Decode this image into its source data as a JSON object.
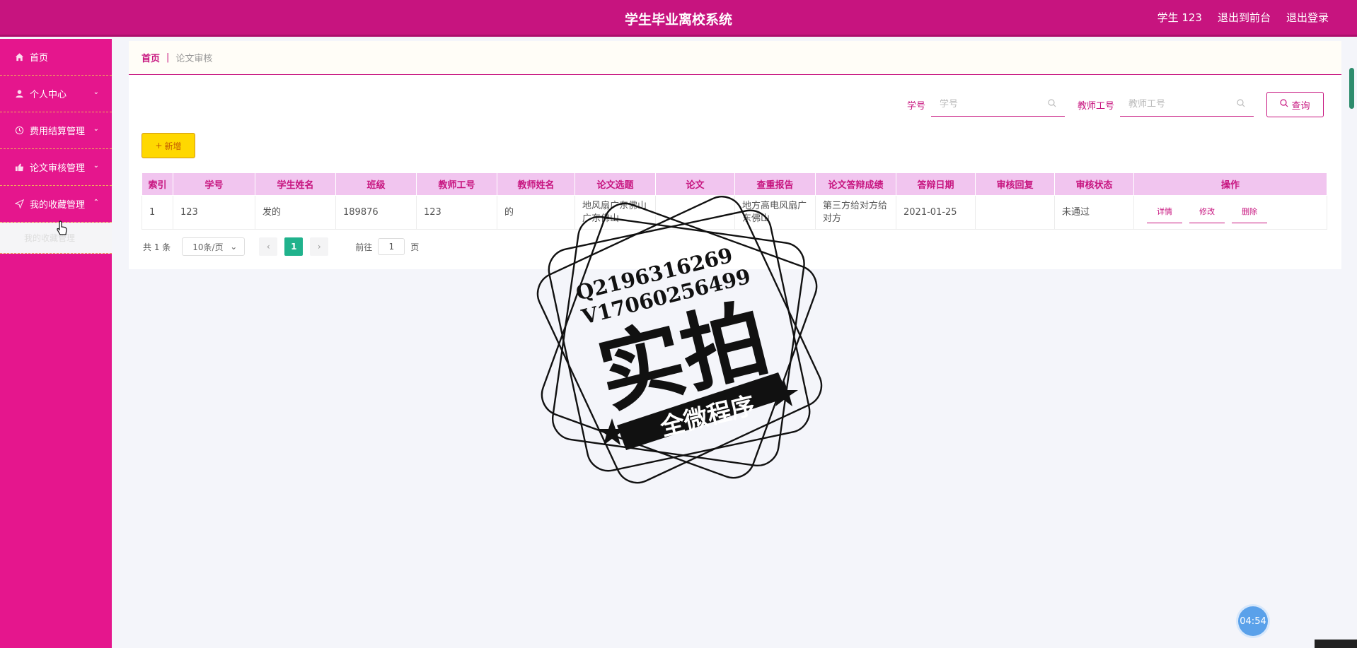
{
  "header": {
    "title": "学生毕业离校系统",
    "user": "学生 123",
    "back_front": "退出到前台",
    "logout": "退出登录"
  },
  "sidebar": {
    "items": [
      {
        "label": "首页",
        "icon": "home-icon"
      },
      {
        "label": "个人中心",
        "icon": "user-icon"
      },
      {
        "label": "费用结算管理",
        "icon": "clock-icon"
      },
      {
        "label": "论文审核管理",
        "icon": "thumb-icon"
      },
      {
        "label": "我的收藏管理",
        "icon": "send-icon"
      }
    ],
    "submenu": [
      "我的收藏管理"
    ]
  },
  "breadcrumb": {
    "home": "首页",
    "sep": "|",
    "current": "论文审核"
  },
  "search": {
    "student_label": "学号",
    "student_placeholder": "学号",
    "teacher_label": "教师工号",
    "teacher_placeholder": "教师工号",
    "button": "查询"
  },
  "toolbar": {
    "add_label": "新增"
  },
  "table": {
    "headers": [
      "索引",
      "学号",
      "学生姓名",
      "班级",
      "教师工号",
      "教师姓名",
      "论文选题",
      "论文",
      "查重报告",
      "论文答辩成绩",
      "答辩日期",
      "审核回复",
      "审核状态",
      "操作"
    ],
    "rows": [
      {
        "index": "1",
        "student_id": "123",
        "student_name": "发的",
        "class": "189876",
        "teacher_id": "123",
        "teacher_name": "的",
        "topic": "地风扇广东佛山广东佛山",
        "paper": "",
        "report": "地方高电风扇广东佛山",
        "score": "第三方给对方给对方",
        "date": "2021-01-25",
        "reply": "",
        "status": "未通过",
        "ops": [
          "详情",
          "修改",
          "删除"
        ]
      }
    ]
  },
  "pager": {
    "total": "共 1 条",
    "size": "10条/页",
    "current": "1",
    "goto_prefix": "前往",
    "goto_value": "1",
    "goto_suffix": "页"
  },
  "watermark": {
    "line1": "Q2196316269",
    "line2": "V17060256499",
    "main": "实拍",
    "banner": "全微程序"
  },
  "timer": "04:54",
  "colors": {
    "primary": "#c7147f",
    "sidebar": "#e5168d",
    "add": "#ffd800",
    "page_active": "#20b28c"
  }
}
